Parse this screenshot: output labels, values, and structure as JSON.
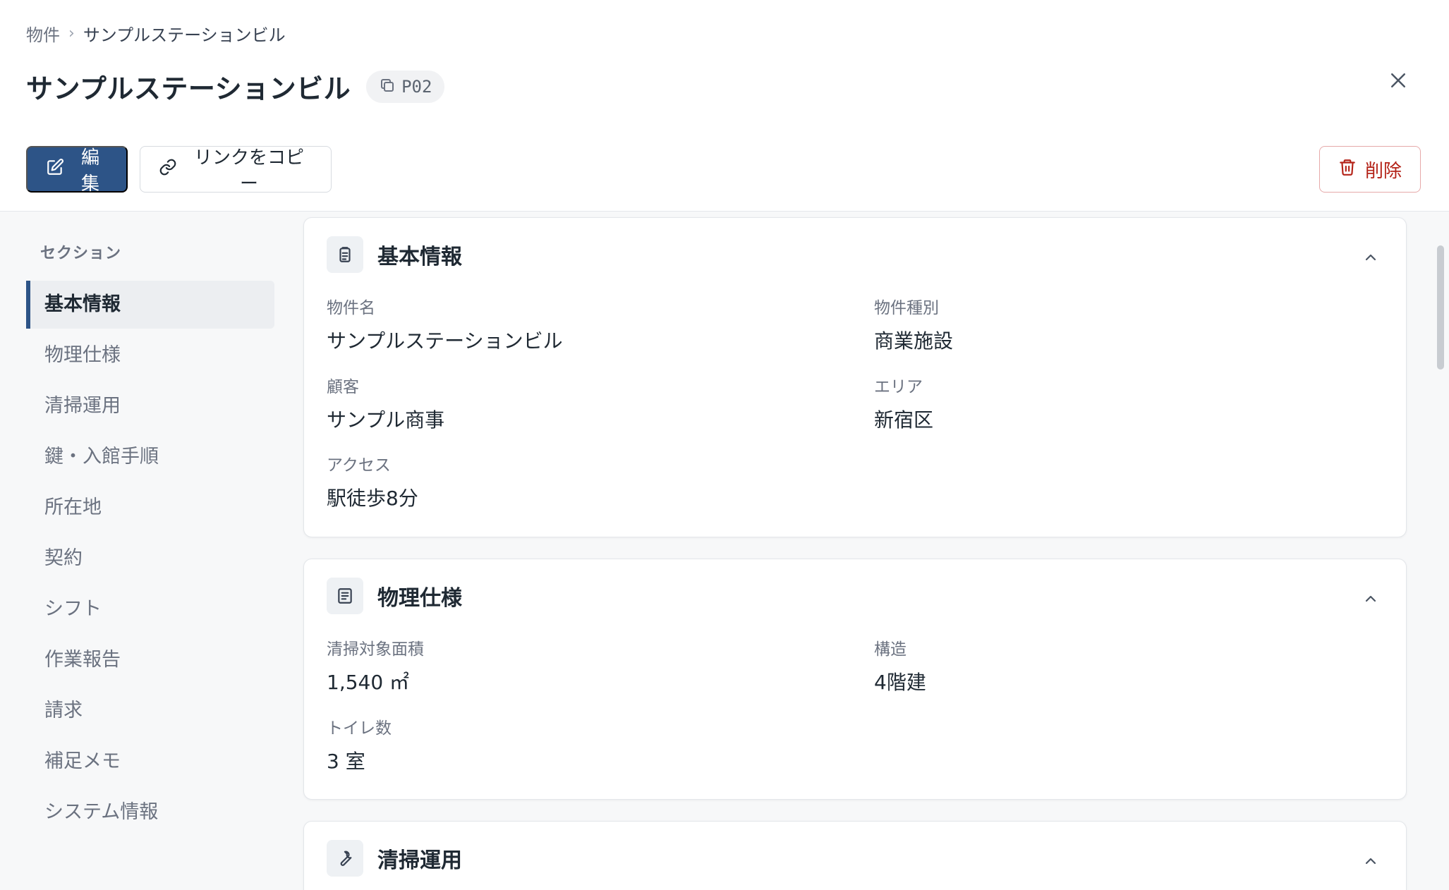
{
  "breadcrumb": {
    "root": "物件",
    "separator": "›",
    "current": "サンプルステーションビル"
  },
  "header": {
    "title": "サンプルステーションビル",
    "code": "P02"
  },
  "toolbar": {
    "edit_label": "編集",
    "copy_link_label": "リンクをコピー",
    "delete_label": "削除"
  },
  "sidebar": {
    "heading": "セクション",
    "items": [
      {
        "label": "基本情報",
        "active": true
      },
      {
        "label": "物理仕様"
      },
      {
        "label": "清掃運用"
      },
      {
        "label": "鍵・入館手順"
      },
      {
        "label": "所在地"
      },
      {
        "label": "契約"
      },
      {
        "label": "シフト"
      },
      {
        "label": "作業報告"
      },
      {
        "label": "請求"
      },
      {
        "label": "補足メモ"
      },
      {
        "label": "システム情報"
      }
    ]
  },
  "sections": {
    "basic": {
      "title": "基本情報",
      "fields": [
        {
          "label": "物件名",
          "value": "サンプルステーションビル"
        },
        {
          "label": "物件種別",
          "value": "商業施設"
        },
        {
          "label": "顧客",
          "value": "サンプル商事"
        },
        {
          "label": "エリア",
          "value": "新宿区"
        },
        {
          "label": "アクセス",
          "value": "駅徒歩8分"
        }
      ]
    },
    "physical": {
      "title": "物理仕様",
      "fields": [
        {
          "label": "清掃対象面積",
          "value": "1,540 ㎡"
        },
        {
          "label": "構造",
          "value": "4階建"
        },
        {
          "label": "トイレ数",
          "value": "3 室"
        }
      ]
    },
    "cleaning": {
      "title": "清掃運用"
    }
  },
  "colors": {
    "primary": "#2d5487",
    "danger": "#b42318",
    "active_bar": "#2d5487"
  }
}
